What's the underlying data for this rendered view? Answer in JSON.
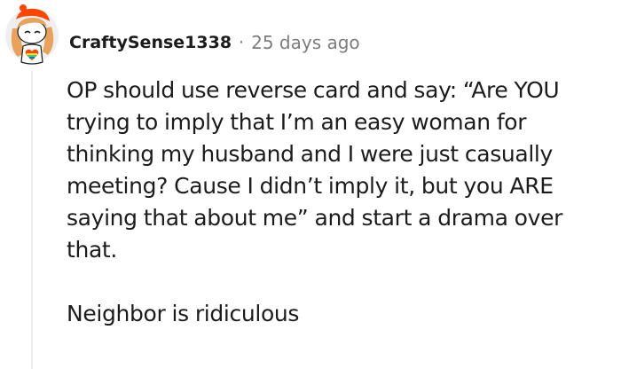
{
  "comment": {
    "username": "CraftySense1338",
    "separator": "·",
    "timestamp": "25 days ago",
    "paragraphs": [
      "OP should use reverse card and say: “Are YOU trying to imply that I’m an easy woman for thinking my husband and I were just casually meeting? Cause I didn’t imply it, but you ARE saying that about me” and start a drama over that.",
      "Neighbor is ridiculous"
    ],
    "avatar": {
      "icon": "snoo-avatar-icon",
      "hair_color": "#e8a25a",
      "hat_color": "#ff4500",
      "circle_color": "#edeff1"
    }
  }
}
